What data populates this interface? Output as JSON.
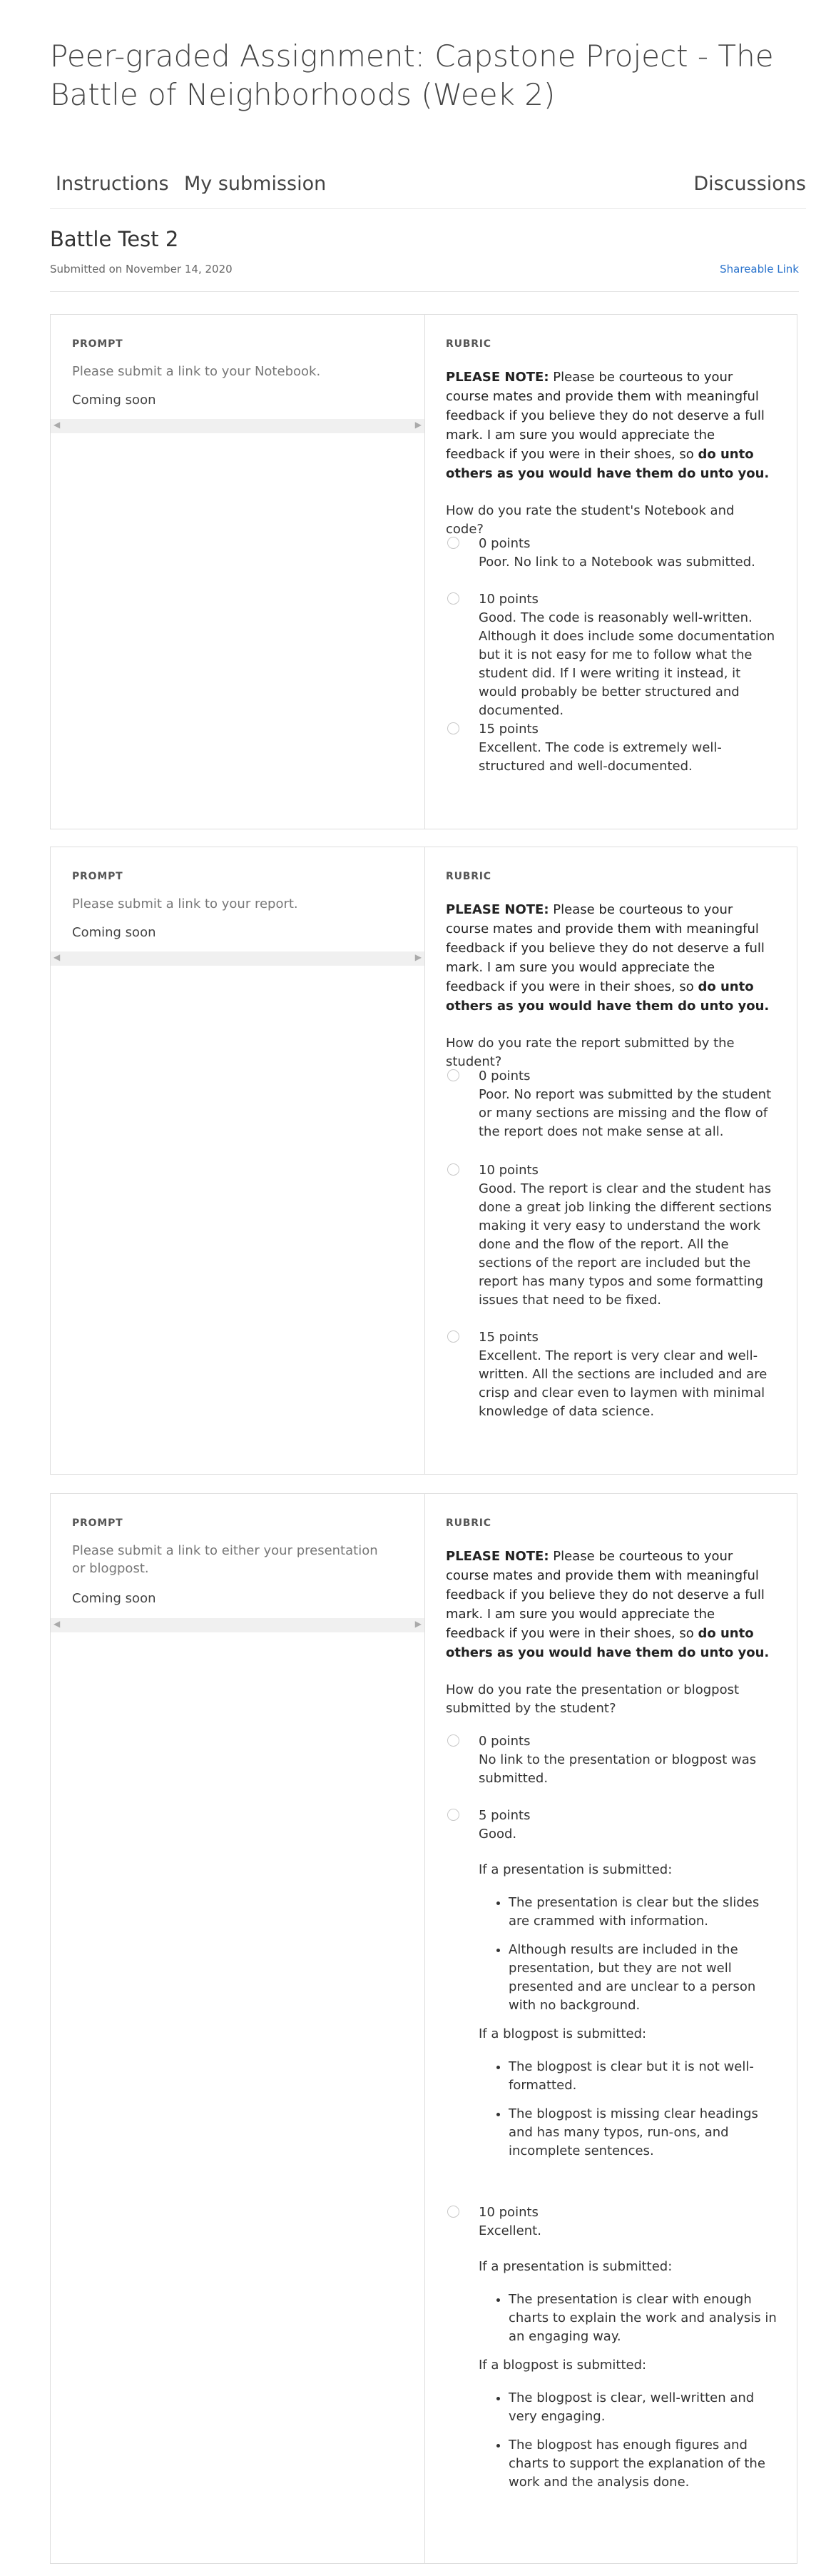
{
  "header": {
    "title": "Peer-graded Assignment: Capstone Project - The Battle of Neighborhoods (Week 2)"
  },
  "nav": {
    "instructions": "Instructions",
    "my_submission": "My submission",
    "discussions": "Discussions"
  },
  "submission": {
    "title": "Battle Test 2",
    "date": "Submitted on November 14, 2020",
    "share_link": "Shareable Link"
  },
  "labels": {
    "prompt": "PROMPT",
    "rubric": "RUBRIC"
  },
  "note": {
    "bold_lead": "PLEASE NOTE:",
    "text": " Please be courteous to your course mates and provide them with meaningful feedback if you believe they do not deserve a full mark. I am sure you would appreciate the feedback if you were in their shoes, so ",
    "bold_tail": "do unto others as you would have them do unto you."
  },
  "questions": [
    {
      "prompt": "Please submit a link to your Notebook.",
      "status": "Coming soon",
      "rubric_question": "How do you rate the student's Notebook and code?",
      "options": [
        {
          "points": "0 points",
          "desc": "Poor. No link to a Notebook was submitted."
        },
        {
          "points": "10 points",
          "desc": "Good. The code is reasonably well-written. Although it does include some documentation but it is not easy for me to follow what the student did. If I were writing it instead, it would probably be better structured and documented."
        },
        {
          "points": "15 points",
          "desc": "Excellent. The code is extremely well-structured and well-documented."
        }
      ]
    },
    {
      "prompt": "Please submit a link to your report.",
      "status": "Coming soon",
      "rubric_question": "How do you rate the report submitted by the student?",
      "options": [
        {
          "points": "0 points",
          "desc": "Poor. No report was submitted by the student or many sections are missing and the flow of the report does not make sense at all."
        },
        {
          "points": "10 points",
          "desc": "Good. The report is clear and the student has done a great job linking the different sections making it very easy to understand the work done and the flow of the report. All the sections of the report are included but the report has many typos and some formatting issues that need to be fixed."
        },
        {
          "points": "15 points",
          "desc": "Excellent. The report is very clear and well-written. All the sections are included and are crisp and clear even to laymen with minimal knowledge of data science."
        }
      ]
    },
    {
      "prompt": "Please submit a link to either your presentation or blogpost.",
      "status": "Coming soon",
      "rubric_question": "How do you rate the presentation or blogpost submitted by the student?",
      "options": [
        {
          "points": "0 points",
          "desc": "No link to the presentation or blogpost was submitted."
        },
        {
          "points": "5 points",
          "desc": "Good.",
          "presentation_heading": "If a presentation is submitted:",
          "presentation_bullets": [
            "The presentation is clear but the slides are crammed with information.",
            "Although results are included in the presentation, but they are not well presented and are unclear to a person with no background."
          ],
          "blog_heading": "If a blogpost is submitted:",
          "blog_bullets": [
            "The blogpost is clear but it is not well-formatted.",
            "The blogpost is missing clear headings and has many typos, run-ons, and incomplete sentences."
          ]
        },
        {
          "points": "10 points",
          "desc": "Excellent.",
          "presentation_heading": "If a presentation is submitted:",
          "presentation_bullets": [
            "The presentation is clear with enough charts to explain the work and analysis in an engaging way."
          ],
          "blog_heading": "If a blogpost is submitted:",
          "blog_bullets": [
            "The blogpost is clear, well-written and very engaging.",
            "The blogpost has enough figures and charts to support the explanation of the work and the analysis done."
          ]
        }
      ]
    }
  ]
}
